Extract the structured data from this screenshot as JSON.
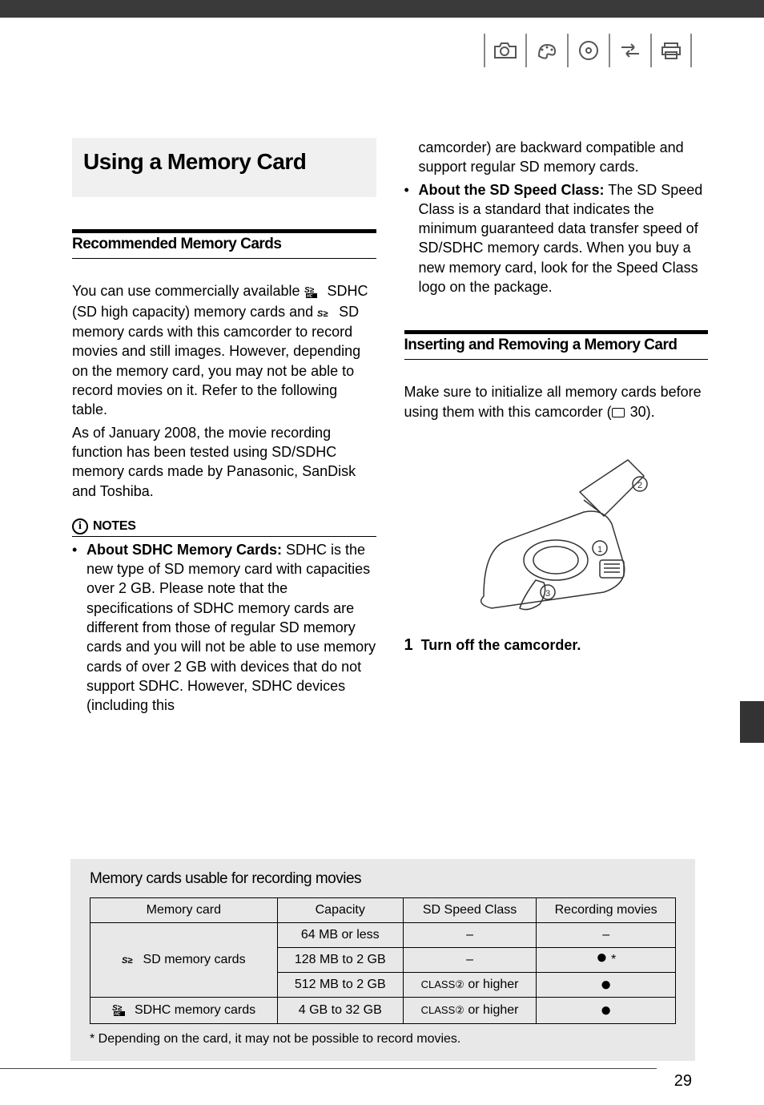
{
  "icons": [
    "camera-icon",
    "paint-icon",
    "disc-icon",
    "transfer-icon",
    "print-icon"
  ],
  "main_heading": "Using a Memory Card",
  "sec1": {
    "heading": "Recommended Memory Cards",
    "p1a": "You can use commercially available ",
    "p1b": " SDHC (SD high capacity) memory cards and ",
    "p1c": " SD memory cards with this camcorder to record movies and still images. However, depending on the memory card, you may not be able to record movies on it. Refer to the following table.",
    "p2": "As of January 2008, the movie recording function has been tested using SD/SDHC memory cards made by Panasonic, SanDisk and Toshiba."
  },
  "notes_label": "NOTES",
  "note1_lead": "About SDHC Memory Cards:",
  "note1_body": " SDHC is the new type of SD memory card with capacities over 2 GB. Please note that the specifications of SDHC memory cards are different from those of regular SD memory cards and you will not be able to use memory cards of over 2 GB with devices that do not support SDHC. However, SDHC devices (including this ",
  "note1_cont": "camcorder) are backward compatible and support regular SD memory cards.",
  "note2_lead": "About the SD Speed Class:",
  "note2_body": " The SD Speed Class is a standard that indicates the minimum guaranteed data transfer speed of SD/SDHC memory cards. When you buy a new memory card, look for the Speed Class logo on the package.",
  "sec2": {
    "heading": "Inserting and Removing a Memory Card",
    "p1a": "Make sure to initialize all memory cards before using them with this camcorder (",
    "p1_ref": " 30).",
    "step_num": "1",
    "step_text": "Turn off the camcorder."
  },
  "table": {
    "title": "Memory cards usable for recording movies",
    "headers": [
      "Memory card",
      "Capacity",
      "SD Speed Class",
      "Recording movies"
    ],
    "rows": [
      {
        "card": " SD memory cards",
        "capacity": "64 MB or less",
        "speed": "–",
        "rec": "–"
      },
      {
        "capacity": "128 MB to 2 GB",
        "speed": "–",
        "rec": "●*"
      },
      {
        "capacity": "512 MB to 2 GB",
        "speed_prefix": "CLASS",
        "speed_suffix": " or higher",
        "rec": "●"
      },
      {
        "card": " SDHC memory cards",
        "capacity": "4 GB to 32 GB",
        "speed_prefix": "CLASS",
        "speed_suffix": " or higher",
        "rec": "●"
      }
    ],
    "footnote": "* Depending on the card, it may not be possible to record movies."
  },
  "page_number": "29"
}
